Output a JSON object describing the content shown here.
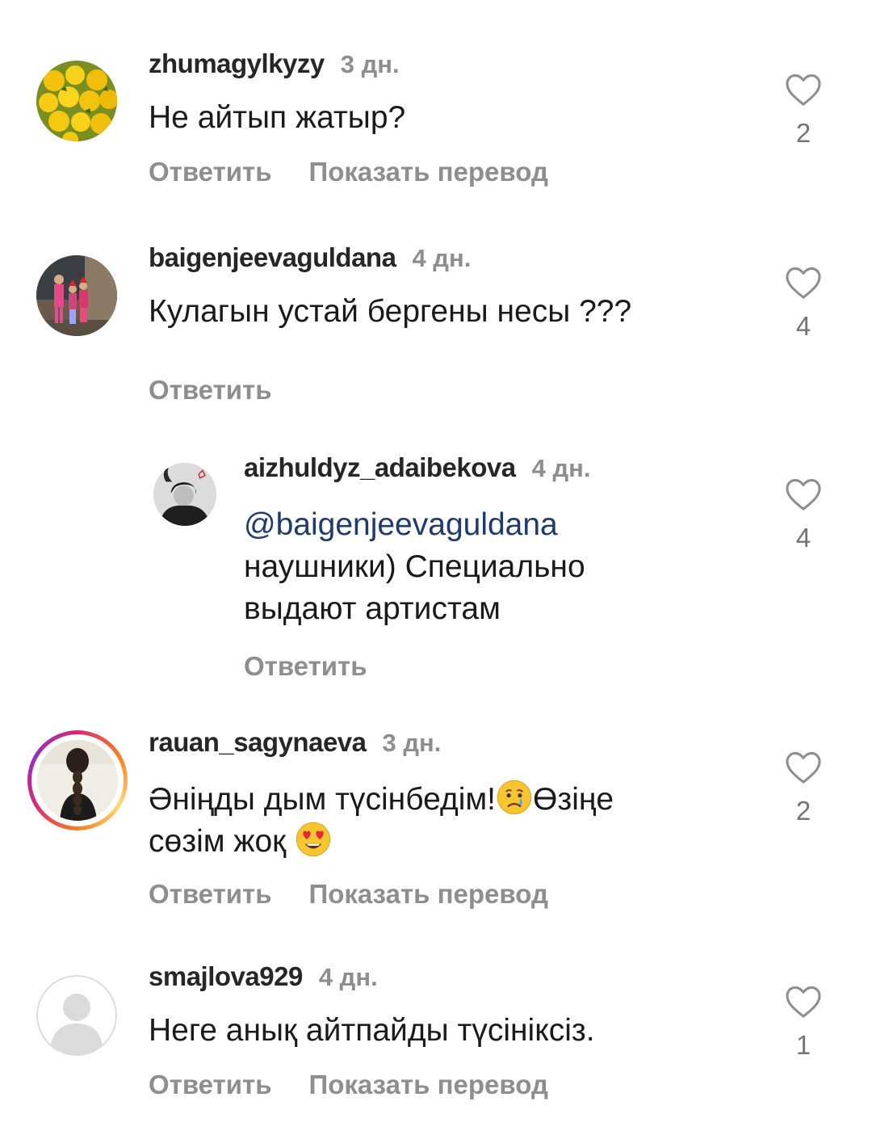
{
  "comments": [
    {
      "username": "zhumagylkyzy",
      "time": "3 дн.",
      "text": "Не айтып жатыр?",
      "reply_label": "Ответить",
      "translate_label": "Показать перевод",
      "likes": "2",
      "avatar": "oranges-photo"
    },
    {
      "username": "baigenjeevaguldana",
      "time": "4 дн.",
      "text": "Кулагын устай бергены несы ???",
      "reply_label": "Ответить",
      "likes": "4",
      "avatar": "children-photo"
    },
    {
      "username": "aizhuldyz_adaibekova",
      "time": "4 дн.",
      "mention": "@baigenjeevaguldana",
      "text_line1": "наушники) Специально",
      "text_line2": "выдают артистам",
      "reply_label": "Ответить",
      "likes": "4",
      "avatar": "bw-portrait-photo"
    },
    {
      "username": "rauan_sagynaeva",
      "time": "3 дн.",
      "text_part1": "Әніңды дым түсінбедім!",
      "text_part2": "Өзіңе",
      "text_part3": "сөзім жоқ",
      "emoji1": "crying-face-emoji",
      "emoji2": "heart-eyes-emoji",
      "reply_label": "Ответить",
      "translate_label": "Показать перевод",
      "likes": "2",
      "avatar": "braid-photo"
    },
    {
      "username": "smajlova929",
      "time": "4 дн.",
      "text": "Неге анық айтпайды түсініксіз.",
      "reply_label": "Ответить",
      "translate_label": "Показать перевод",
      "likes": "1",
      "avatar": "default-avatar"
    }
  ]
}
